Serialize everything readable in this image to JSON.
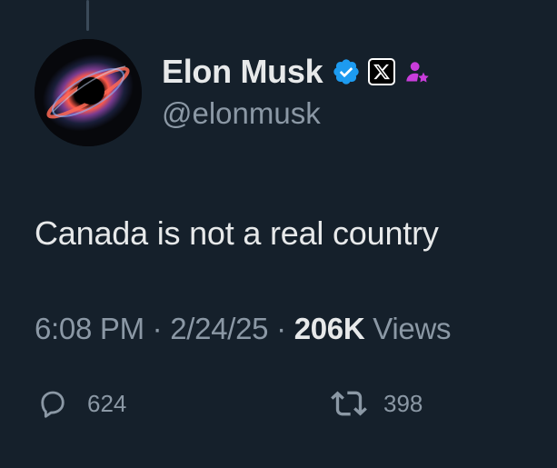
{
  "author": {
    "display_name": "Elon Musk",
    "handle": "@elonmusk",
    "avatar_icon": "black-hole-avatar",
    "badges": [
      "verified-badge-icon",
      "x-affiliate-badge-icon",
      "affiliate-person-icon"
    ]
  },
  "tweet": {
    "text": "Canada is not a real country"
  },
  "meta": {
    "time": "6:08 PM",
    "sep1": " · ",
    "date": "2/24/25",
    "sep2": " · ",
    "views_count": "206K",
    "views_label": " Views"
  },
  "actions": {
    "reply_count": "624",
    "retweet_count": "398"
  },
  "colors": {
    "background": "#15202b",
    "text_primary": "#e7e9ea",
    "text_secondary": "#8b98a5",
    "verified_blue": "#1d9bf0",
    "affiliate_magenta": "#c93ddb"
  }
}
